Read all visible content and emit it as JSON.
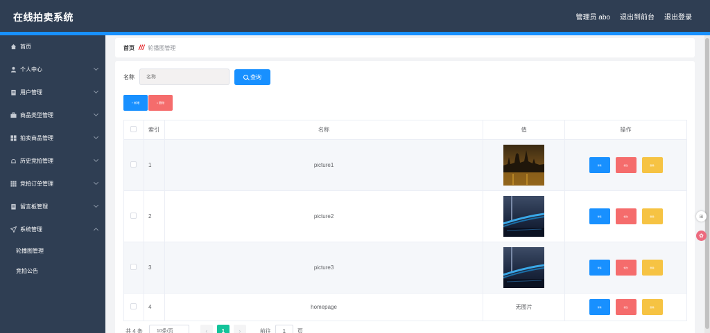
{
  "app": {
    "title": "在线拍卖系统"
  },
  "header": {
    "admin_label": "管理员 abo",
    "front_label": "退出到前台",
    "logout_label": "退出登录"
  },
  "sidebar": {
    "items": [
      {
        "label": "首页",
        "icon": "home-icon",
        "expandable": false
      },
      {
        "label": "个人中心",
        "icon": "user-icon",
        "expandable": true
      },
      {
        "label": "用户管理",
        "icon": "clipboard-icon",
        "expandable": true
      },
      {
        "label": "商品类型管理",
        "icon": "briefcase-icon",
        "expandable": true
      },
      {
        "label": "拍卖商品管理",
        "icon": "grid-icon",
        "expandable": true
      },
      {
        "label": "历史竞拍管理",
        "icon": "bell-icon",
        "expandable": true
      },
      {
        "label": "竞拍订单管理",
        "icon": "grid9-icon",
        "expandable": true
      },
      {
        "label": "留言板管理",
        "icon": "clipboard-icon",
        "expandable": true
      },
      {
        "label": "系统管理",
        "icon": "send-icon",
        "expandable": true,
        "expanded": true
      }
    ],
    "sub_items": [
      "轮播图管理",
      "竞拍公告"
    ]
  },
  "breadcrumb": {
    "home": "首页",
    "current": "轮播图管理"
  },
  "search": {
    "label": "名称",
    "placeholder": "名称",
    "button": "查询"
  },
  "actions": {
    "add": "+ 新增",
    "delete": "× 删除"
  },
  "table": {
    "headers": {
      "index": "索引",
      "name": "名称",
      "value": "值",
      "ops": "操作"
    },
    "rows": [
      {
        "index": "1",
        "name": "picture1",
        "value_type": "image",
        "image": "city-night-icon"
      },
      {
        "index": "2",
        "name": "picture2",
        "value_type": "image",
        "image": "bridge-night-icon"
      },
      {
        "index": "3",
        "name": "picture3",
        "value_type": "image",
        "image": "bridge-night-icon"
      },
      {
        "index": "4",
        "name": "homepage",
        "value_type": "text",
        "value": "无图片"
      }
    ],
    "row_ops": {
      "detail": "详情",
      "edit": "修改",
      "delete": "删除"
    }
  },
  "pagination": {
    "total": "共 4 条",
    "page_size": "10条/页",
    "current_page": "1",
    "goto_prefix": "前往",
    "goto_value": "1",
    "goto_suffix": "页"
  },
  "colors": {
    "header_bg": "#2f3e53",
    "accent": "#1890ff",
    "danger": "#f56c6c",
    "warning": "#f6c343",
    "page_active": "#13c39a"
  }
}
